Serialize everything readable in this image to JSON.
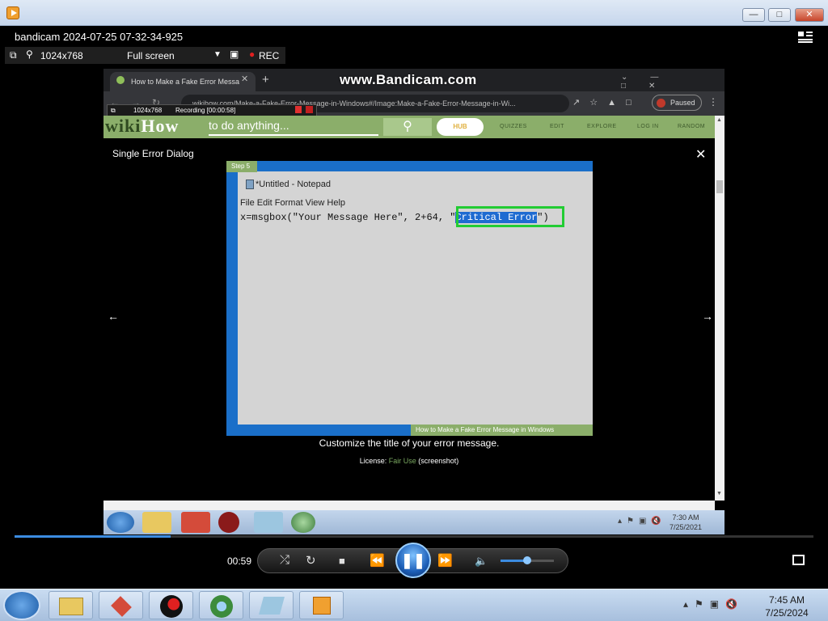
{
  "window": {
    "title": "bandicam 2024-07-25 07-32-34-925"
  },
  "recorder_bar": {
    "resolution": "1024x768",
    "mode": "Full screen",
    "rec_label": "REC"
  },
  "browser": {
    "tab_title": "How to Make a Fake Error Messa",
    "watermark": "www.Bandicam.com",
    "url": "wikihow.com/Make-a-Fake-Error-Message-in-Windows#/Image:Make-a-Fake-Error-Message-in-Wi...",
    "profile_status": "Paused",
    "inner_recorder": {
      "resolution": "1024x768",
      "status": "Recording [00:00:58]"
    }
  },
  "wikihow": {
    "logo_wiki": "wiki",
    "logo_how": "How",
    "search_placeholder": "to do anything...",
    "hub_label": "HUB",
    "nav": [
      "QUIZZES",
      "EDIT",
      "EXPLORE",
      "LOG IN",
      "RANDOM"
    ]
  },
  "modal": {
    "title": "Single Error Dialog",
    "step_tag": "Step 5",
    "notepad_title": "*Untitled - Notepad",
    "notepad_menu": "File  Edit  Format  View  Help",
    "code_prefix": "x=msgbox(\"Your Message Here\", 2+64, ",
    "code_quote_open": "\"",
    "code_selected": "Critical Error",
    "code_suffix": "\")",
    "image_credit": "How to Make a Fake Error Message in Windows",
    "caption": "Customize the title of your error message.",
    "license_prefix": "License: ",
    "license_link": "Fair Use",
    "license_suffix": " (screenshot)"
  },
  "inner_taskbar": {
    "time": "7:30 AM",
    "date": "7/25/2021"
  },
  "player": {
    "elapsed": "00:59",
    "progress_fraction": 0.19,
    "volume_fraction": 0.5
  },
  "taskbar": {
    "time": "7:45 AM",
    "date": "7/25/2024"
  }
}
